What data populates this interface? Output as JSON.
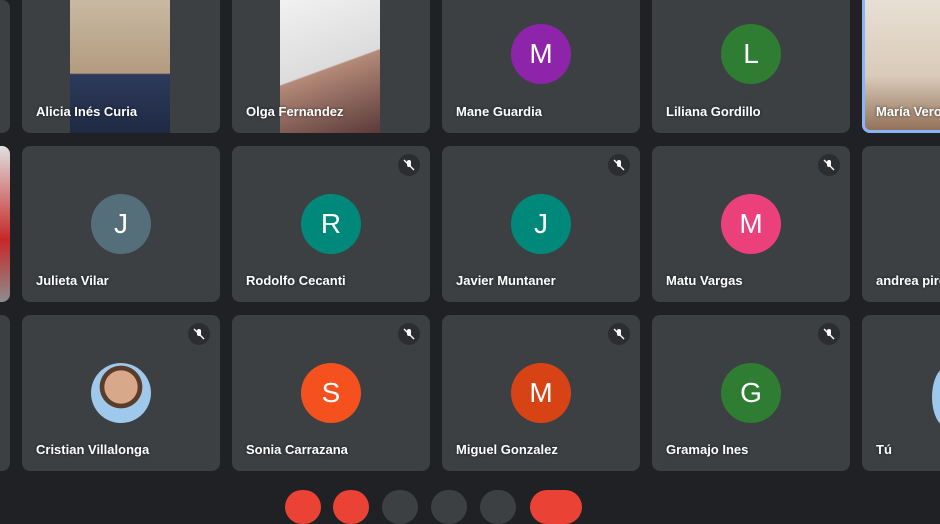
{
  "participants": [
    {
      "name": "Alicia Inés Curia"
    },
    {
      "name": "Olga Fernandez"
    },
    {
      "name": "Mane Guardia",
      "initial": "M",
      "color": "#8e24aa"
    },
    {
      "name": "Liliana Gordillo",
      "initial": "L",
      "color": "#2e7d32"
    },
    {
      "name": "María Vero"
    },
    {
      "name": "Julieta Vilar",
      "initial": "J",
      "color": "#546e7a"
    },
    {
      "name": "Rodolfo Cecanti",
      "initial": "R",
      "color": "#00897b"
    },
    {
      "name": "Javier Muntaner",
      "initial": "J",
      "color": "#00897b"
    },
    {
      "name": "Matu Vargas",
      "initial": "M",
      "color": "#ec407a"
    },
    {
      "name": "andrea pire"
    },
    {
      "name": "Cristian Villalonga"
    },
    {
      "name": "Sonia Carrazana",
      "initial": "S",
      "color": "#f4511e"
    },
    {
      "name": "Miguel Gonzalez",
      "initial": "M",
      "color": "#d84315"
    },
    {
      "name": "Gramajo Ines",
      "initial": "G",
      "color": "#2e7d32"
    },
    {
      "name": "Tú"
    }
  ],
  "icons": {
    "muted": "mic-off-icon"
  }
}
